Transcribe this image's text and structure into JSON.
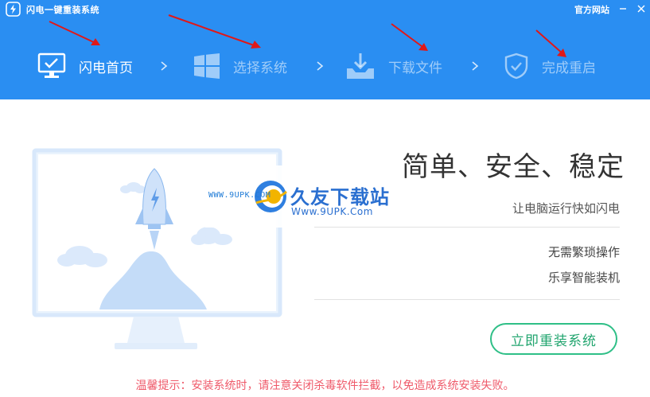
{
  "window": {
    "title": "闪电一键重装系统",
    "official_site": "官方网站",
    "minimize_glyph": "—",
    "close_glyph": "✕"
  },
  "colors": {
    "header_bg": "#2a8ef2",
    "accent_green": "#2fbf87",
    "tip_red": "#ef5a6a"
  },
  "steps": [
    {
      "label": "闪电首页",
      "icon": "monitor-icon",
      "active": true
    },
    {
      "label": "选择系统",
      "icon": "windows-icon",
      "active": false
    },
    {
      "label": "下载文件",
      "icon": "download-icon",
      "active": false
    },
    {
      "label": "完成重启",
      "icon": "shield-check-icon",
      "active": false
    }
  ],
  "watermark": {
    "small": "WWW.9UPK.COM",
    "big": "久友下载站",
    "url": "Www.9UPK.Com"
  },
  "main": {
    "headline": "简单、安全、稳定",
    "subline": "让电脑运行快如闪电",
    "features": [
      "无需繁琐操作",
      "乐享智能装机"
    ],
    "reinstall_button": "立即重装系统"
  },
  "tip": "温馨提示：安装系统时，请注意关闭杀毒软件拦截，以免造成系统安装失败。"
}
